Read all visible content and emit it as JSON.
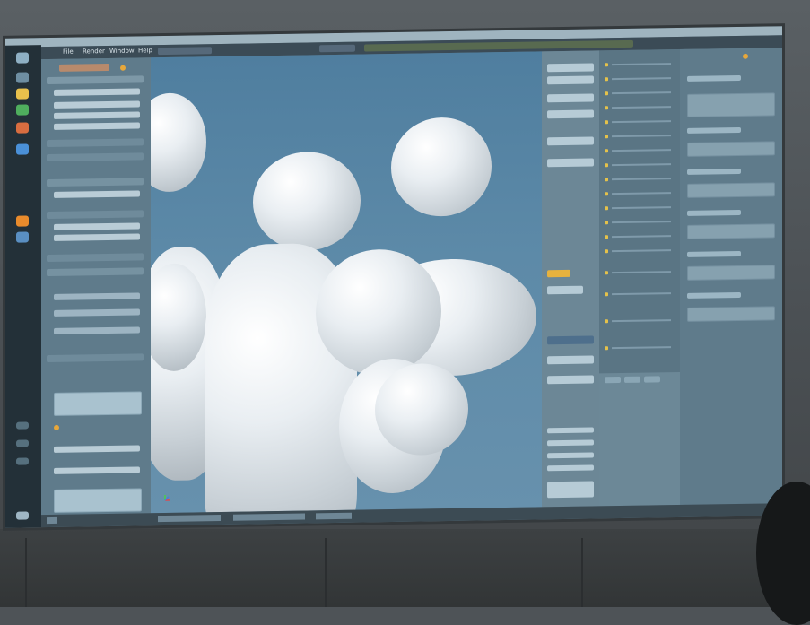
{
  "scene": {
    "wall_color": "#505559",
    "floor_color": "#383c3e",
    "screen_color": "#5d7583"
  },
  "app": {
    "menu": [
      "File",
      "Render",
      "Window",
      "Help"
    ],
    "accent_color": "#e7a73a"
  },
  "viewport": {
    "background": "#5d8aa8",
    "object_color": "#e6ecf0"
  },
  "icons": [
    "windows-icon",
    "chrome-icon",
    "folder-icon",
    "blender-icon"
  ]
}
